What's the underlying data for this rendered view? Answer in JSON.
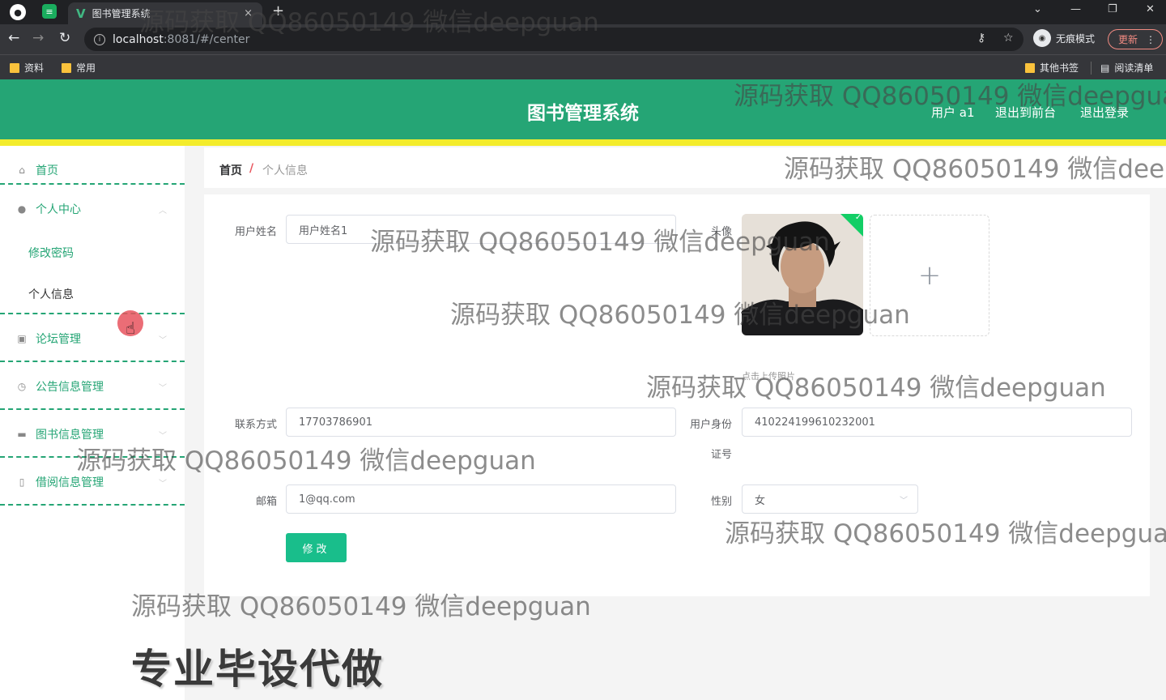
{
  "browser": {
    "tab_title": "图书管理系统",
    "tab_close": "×",
    "new_tab": "+",
    "url_host": "localhost",
    "url_rest": ":8081/#/center",
    "incognito_label": "无痕模式",
    "update_label": "更新",
    "bookmarks": [
      "资料",
      "常用"
    ],
    "other_bookmarks": "其他书签",
    "reading_list": "阅读清单"
  },
  "header": {
    "title": "图书管理系统",
    "user_label": "用户 a1",
    "to_front": "退出到前台",
    "logout": "退出登录"
  },
  "sidebar": {
    "home": "首页",
    "personal_center": "个人中心",
    "change_password": "修改密码",
    "personal_info": "个人信息",
    "forum_manage": "论坛管理",
    "notice_manage": "公告信息管理",
    "book_manage": "图书信息管理",
    "borrow_manage": "借阅信息管理"
  },
  "breadcrumb": {
    "home": "首页",
    "separator": "/",
    "current": "个人信息"
  },
  "form": {
    "username_label": "用户姓名",
    "username_value": "用户姓名1",
    "avatar_label": "头像",
    "upload_tip": "点击上传照片",
    "upload_plus": "+",
    "phone_label": "联系方式",
    "phone_value": "17703786901",
    "idcard_label_1": "用户身份",
    "idcard_label_2": "证号",
    "idcard_value": "410224199610232001",
    "email_label": "邮箱",
    "email_value": "1@qq.com",
    "gender_label": "性别",
    "gender_value": "女",
    "submit_label": "修改"
  },
  "overlay": {
    "watermark": "源码获取 QQ86050149 微信deepguan",
    "watermark_cut": "源码获取 QQ86050149 微信deepg",
    "promo": "专业毕设代做"
  }
}
